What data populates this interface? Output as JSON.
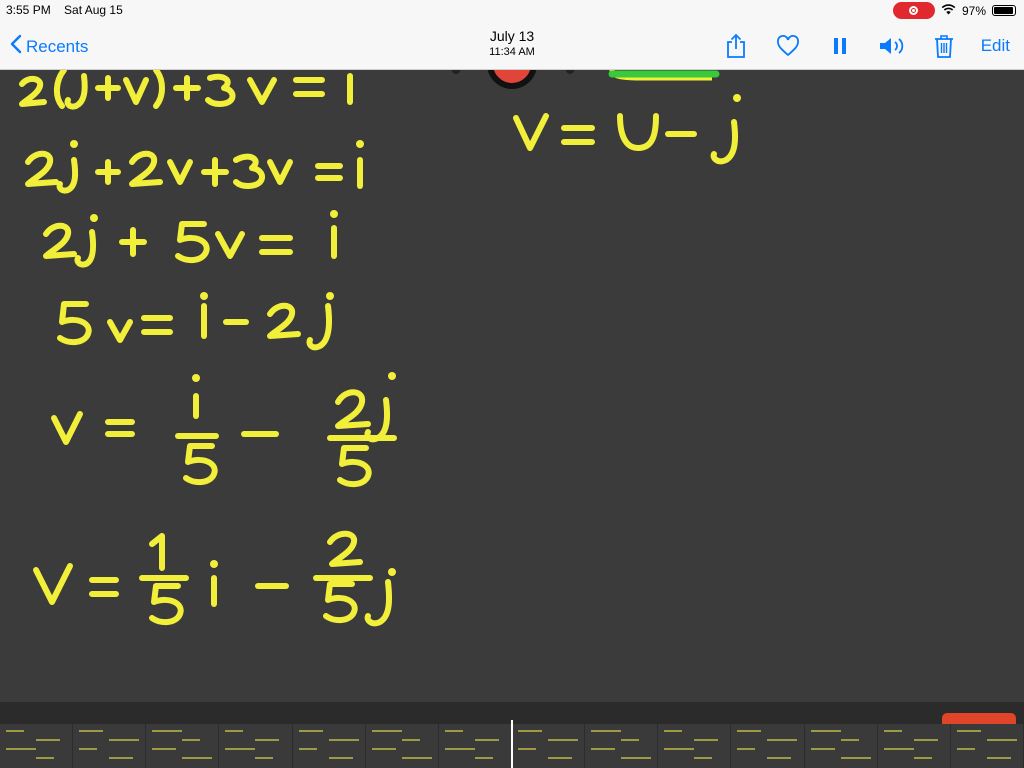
{
  "status_bar": {
    "time": "3:55 PM",
    "date": "Sat Aug 15",
    "battery": "97%",
    "battery_level": 0.97
  },
  "nav": {
    "back_label": "Recents",
    "title": "July 13",
    "subtitle": "11:34 AM",
    "edit_label": "Edit",
    "icons": [
      "share-icon",
      "heart-icon",
      "pause-icon",
      "speaker-icon",
      "trash-icon"
    ],
    "accent_color": "#0a7aff"
  },
  "canvas": {
    "background": "#3b3b3b",
    "ink_color": "#f2ef3a",
    "highlight_color": "#39c93a",
    "equations": [
      "2(j+v)+3v = i",
      "2j + 2v + 3v = i",
      "2j + 5v = i",
      "5v = i - 2j",
      "v = i/5 - 2j/5",
      "v = 1/5 i - 2/5 j",
      "v = u - j"
    ]
  },
  "timeline": {
    "playhead_color": "#ffffff",
    "handle_color": "#e0452a"
  }
}
